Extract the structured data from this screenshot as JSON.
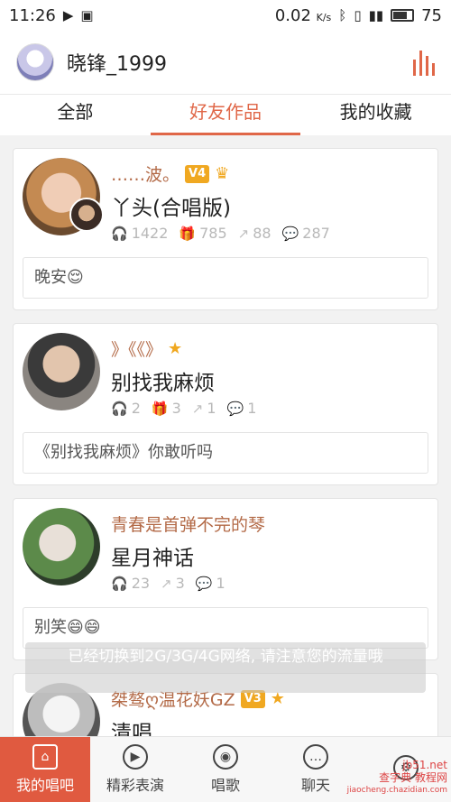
{
  "status_bar": {
    "time": "11:26",
    "speed": "0.02",
    "speed_unit": "K/s",
    "battery": "75"
  },
  "header": {
    "username": "晓锋_1999"
  },
  "tabs": [
    "全部",
    "好友作品",
    "我的收藏"
  ],
  "active_tab": 1,
  "feed": [
    {
      "user": "……波。",
      "vlevel": "4",
      "extra_badge": "crown",
      "song": "丫头(合唱版)",
      "listens": "1422",
      "gifts": "785",
      "shares": "88",
      "comments": "287",
      "comment_text": "晚安😌"
    },
    {
      "user": "》《《》",
      "vlevel": "",
      "extra_badge": "star",
      "song": "别找我麻烦",
      "listens": "2",
      "gifts": "3",
      "shares": "1",
      "comments": "1",
      "comment_text": "《别找我麻烦》你敢听吗"
    },
    {
      "user": "青春是首弹不完的琴",
      "vlevel": "",
      "extra_badge": "",
      "song": "星月神话",
      "listens": "23",
      "gifts": "",
      "shares": "3",
      "comments": "1",
      "comment_text": "别笑😄😄"
    },
    {
      "user": "桀骜ღ温花妖GZ",
      "vlevel": "3",
      "extra_badge": "star",
      "song": "清唱",
      "listens": "",
      "gifts": "",
      "shares": "",
      "comments": "",
      "comment_text": ""
    }
  ],
  "toast": {
    "text": "已经切换到2G/3G/4G网络, 请注意您的流量哦"
  },
  "bottom_nav": [
    {
      "label": "我的唱吧",
      "icon": "home-icon"
    },
    {
      "label": "精彩表演",
      "icon": "play-icon"
    },
    {
      "label": "唱歌",
      "icon": "mic-icon"
    },
    {
      "label": "聊天",
      "icon": "chat-icon"
    },
    {
      "label": "",
      "icon": "more-icon"
    }
  ],
  "watermark": {
    "line1": "jb51.net",
    "line2": "查字典 教程网",
    "line3": "jiaocheng.chazidian.com"
  },
  "colors": {
    "accent": "#e06748",
    "nav_active": "#e05a40",
    "username": "#b36a47"
  }
}
